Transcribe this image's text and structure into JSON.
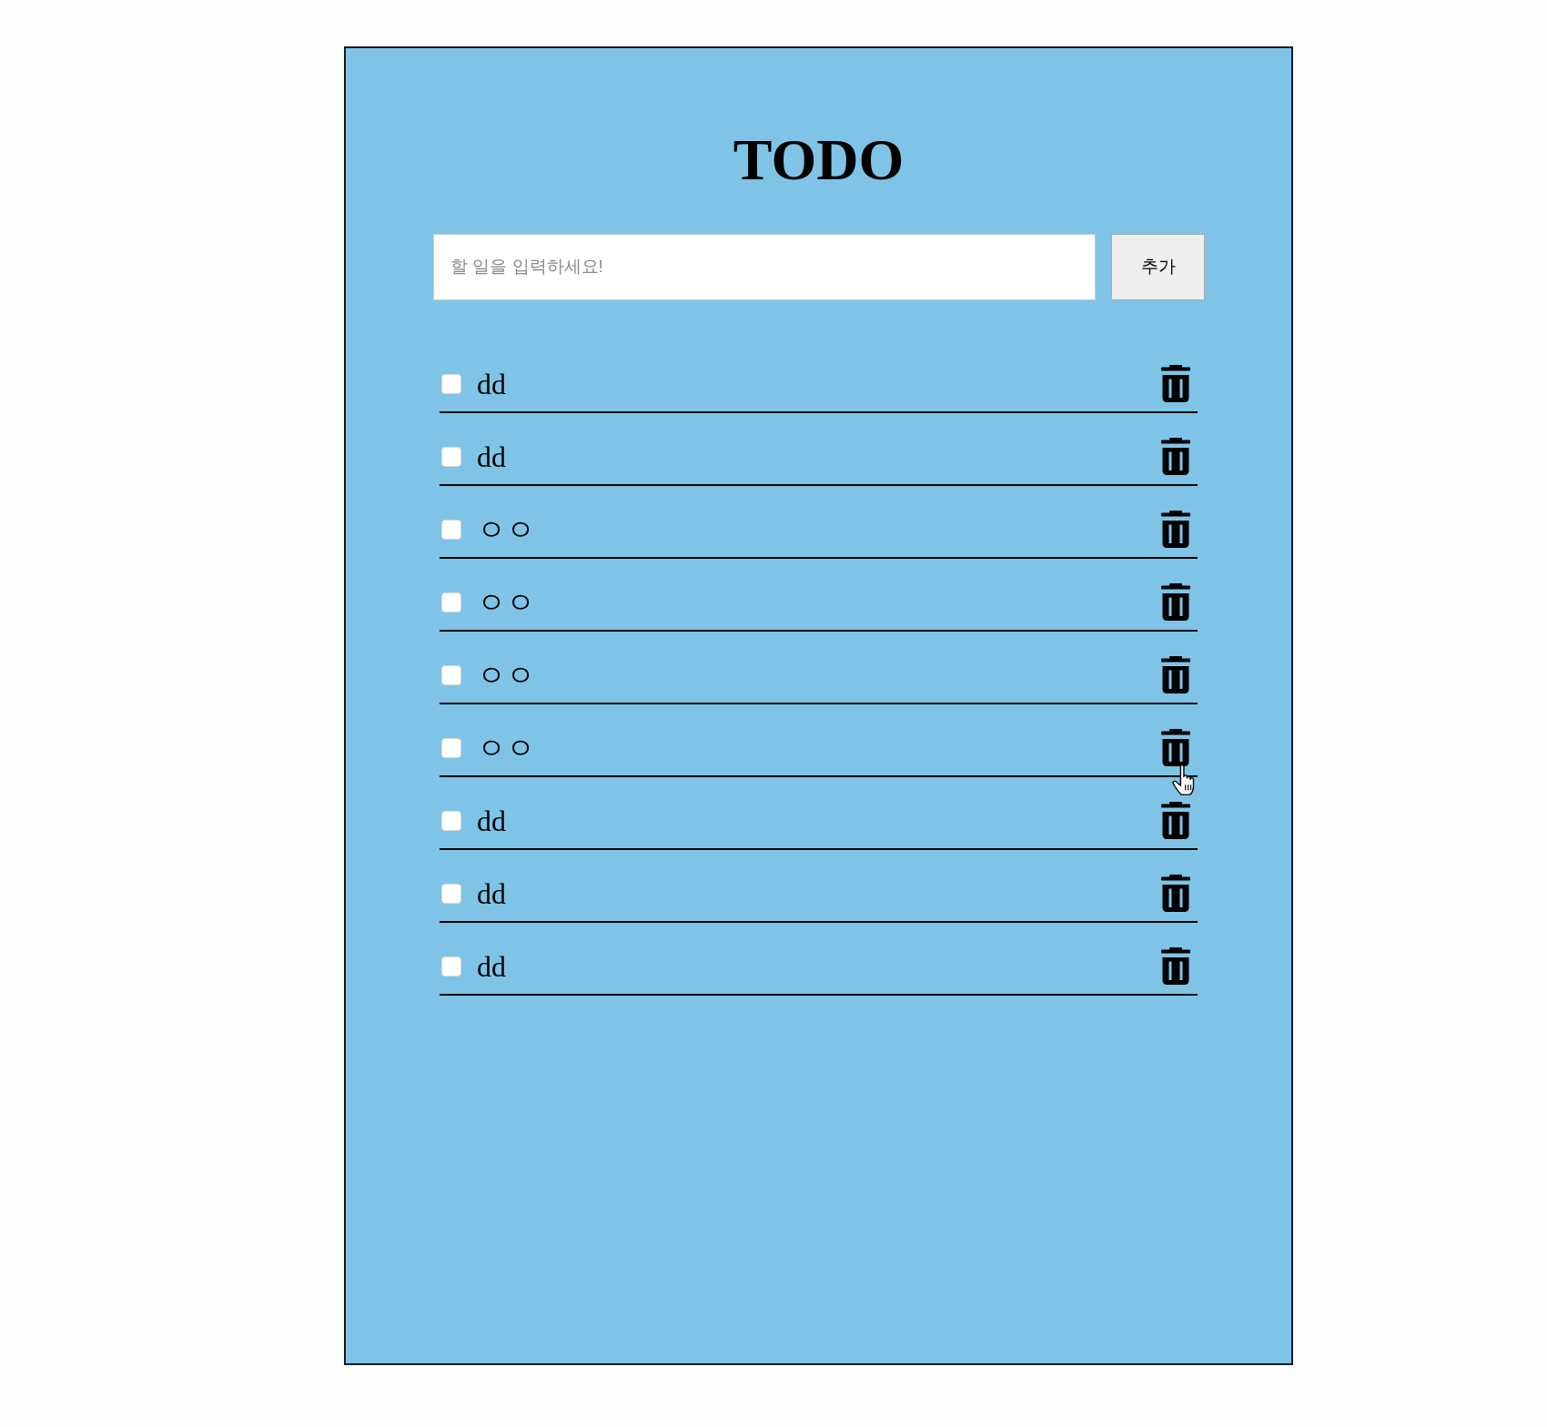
{
  "title": "TODO",
  "new_todo": {
    "placeholder": "할 일을 입력하세요!",
    "button": "추가"
  },
  "todos": [
    {
      "text": "dd",
      "checked": false,
      "hovered": false
    },
    {
      "text": "dd",
      "checked": false,
      "hovered": false
    },
    {
      "text": "ㅇㅇ",
      "checked": false,
      "hovered": false
    },
    {
      "text": "ㅇㅇ",
      "checked": false,
      "hovered": false
    },
    {
      "text": "ㅇㅇ",
      "checked": false,
      "hovered": false
    },
    {
      "text": "ㅇㅇ",
      "checked": false,
      "hovered": true
    },
    {
      "text": "dd",
      "checked": false,
      "hovered": false
    },
    {
      "text": "dd",
      "checked": false,
      "hovered": false
    },
    {
      "text": "dd",
      "checked": false,
      "hovered": false
    }
  ]
}
